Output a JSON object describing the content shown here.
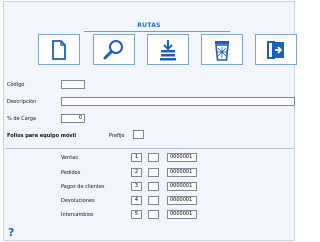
{
  "title": "RUTAS",
  "toolbar": [
    {
      "name": "new-document-button",
      "icon": "new-document-icon"
    },
    {
      "name": "search-button",
      "icon": "magnifier-icon"
    },
    {
      "name": "save-button",
      "icon": "save-stack-icon"
    },
    {
      "name": "delete-button",
      "icon": "trash-icon"
    },
    {
      "name": "exit-button",
      "icon": "exit-icon"
    }
  ],
  "form": {
    "codigo_label": "Código",
    "codigo_value": "",
    "descripcion_label": "Descripción",
    "descripcion_value": "",
    "carga_label": "% de Carga",
    "carga_value": "0",
    "folios_label": "Folios para equipo móvil",
    "prefijo_label": "Prefijo",
    "prefijo_value": ""
  },
  "folios": [
    {
      "label": "Ventas",
      "num": "1",
      "value": "0000001"
    },
    {
      "label": "Pedidos",
      "num": "2",
      "value": "0000001"
    },
    {
      "label": "Pagos de clientes",
      "num": "3",
      "value": "0000001"
    },
    {
      "label": "Devoluciones",
      "num": "4",
      "value": "0000001"
    },
    {
      "label": "Intercambios",
      "num": "5",
      "value": "0000001"
    }
  ],
  "help": "?"
}
